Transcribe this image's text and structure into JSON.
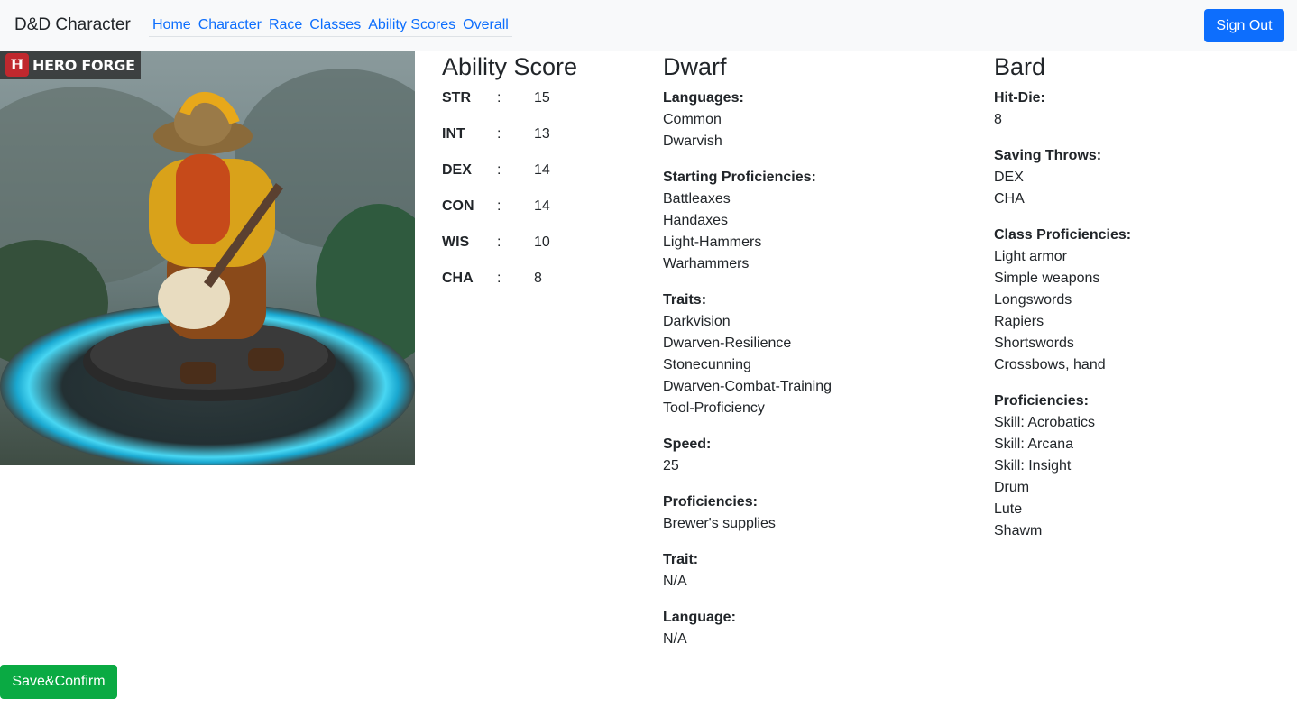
{
  "navbar": {
    "brand": "D&D Character",
    "links": [
      "Home",
      "Character",
      "Race",
      "Classes",
      "Ability Scores",
      "Overall"
    ],
    "signout_label": "Sign Out"
  },
  "portrait": {
    "logo_text": "HERO FORGE",
    "logo_mark": "H"
  },
  "abilities": {
    "title": "Ability Score",
    "separator": ":",
    "scores": [
      {
        "name": "STR",
        "value": "15"
      },
      {
        "name": "INT",
        "value": "13"
      },
      {
        "name": "DEX",
        "value": "14"
      },
      {
        "name": "CON",
        "value": "14"
      },
      {
        "name": "WIS",
        "value": "10"
      },
      {
        "name": "CHA",
        "value": "8"
      }
    ]
  },
  "race": {
    "title": "Dwarf",
    "sections": [
      {
        "title": "Languages:",
        "items": [
          "Common",
          "Dwarvish"
        ]
      },
      {
        "title": "Starting Proficiencies:",
        "items": [
          "Battleaxes",
          "Handaxes",
          "Light-Hammers",
          "Warhammers"
        ]
      },
      {
        "title": "Traits:",
        "items": [
          "Darkvision",
          "Dwarven-Resilience",
          "Stonecunning",
          "Dwarven-Combat-Training",
          "Tool-Proficiency"
        ]
      },
      {
        "title": "Speed:",
        "items": [
          "25"
        ]
      },
      {
        "title": "Proficiencies:",
        "items": [
          "Brewer's supplies"
        ]
      },
      {
        "title": "Trait:",
        "items": [
          "N/A"
        ]
      },
      {
        "title": "Language:",
        "items": [
          "N/A"
        ]
      }
    ]
  },
  "class": {
    "title": "Bard",
    "sections": [
      {
        "title": "Hit-Die:",
        "items": [
          "8"
        ]
      },
      {
        "title": "Saving Throws:",
        "items": [
          "DEX",
          "CHA"
        ]
      },
      {
        "title": "Class Proficiencies:",
        "items": [
          "Light armor",
          "Simple weapons",
          "Longswords",
          "Rapiers",
          "Shortswords",
          "Crossbows, hand"
        ]
      },
      {
        "title": "Proficiencies:",
        "items": [
          "Skill: Acrobatics",
          "Skill: Arcana",
          "Skill: Insight",
          "Drum",
          "Lute",
          "Shawm"
        ]
      }
    ]
  },
  "actions": {
    "save_label": "Save&Confirm"
  },
  "colors": {
    "primary": "#0d6efd",
    "success": "#0aaa43",
    "navbar_bg": "#f8f9fa"
  }
}
